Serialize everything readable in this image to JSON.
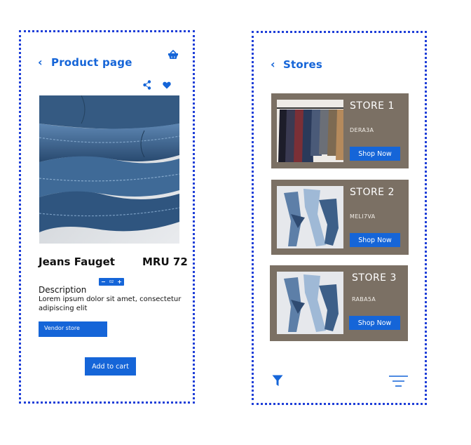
{
  "colors": {
    "accent": "#1565d8",
    "card": "#7b7064",
    "frame": "#1f3fd8"
  },
  "product_page": {
    "back_icon": "chevron-left-icon",
    "title": "Product page",
    "basket_icon": "basket-icon",
    "share_icon": "share-icon",
    "favorite_icon": "heart-icon",
    "image_alt": "folded jeans",
    "name": "Jeans Fauget",
    "price": "MRU 72",
    "stepper": {
      "minus": "−",
      "qty": "02",
      "plus": "+"
    },
    "description_title": "Description",
    "description_text": "Lorem ipsum dolor sit amet, consectetur adipiscing elit",
    "vendor_button": "Vendor store",
    "add_to_cart_button": "Add to cart"
  },
  "stores_page": {
    "back_icon": "chevron-left-icon",
    "title": "Stores",
    "stores": [
      {
        "name": "STORE 1",
        "code": "DERA3A",
        "button": "Shop Now"
      },
      {
        "name": "STORE 2",
        "code": "MELI7VA",
        "button": "Shop Now"
      },
      {
        "name": "STORE 3",
        "code": "RABA5A",
        "button": "Shop Now"
      }
    ],
    "filter_icon": "filter-funnel-icon",
    "sort_icon": "sort-lines-icon"
  }
}
